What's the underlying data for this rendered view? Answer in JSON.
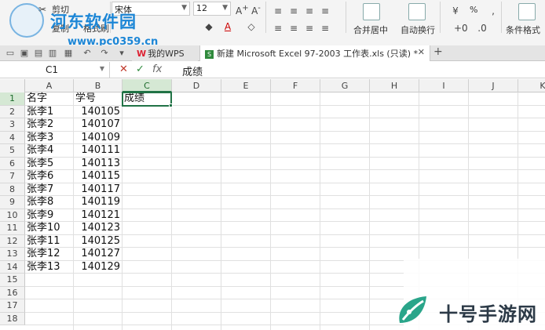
{
  "watermark": {
    "site_name": "河东软件园",
    "site_url": "www.pc0359.cn",
    "corner_brand": "十号手游网"
  },
  "ribbon": {
    "cut_label": "剪切",
    "copy_label": "复制",
    "format_painter_label": "格式刷",
    "font_name": "宋体",
    "font_size": "12",
    "merge_center_label": "合并居中",
    "wrap_text_label": "自动换行",
    "percent_symbol": "%",
    "conditional_format_label": "条件格式"
  },
  "tabs": [
    {
      "label": "我的WPS"
    },
    {
      "label": "新建 Microsoft Excel 97-2003 工作表.xls (只读) *"
    }
  ],
  "formula_bar": {
    "name_box": "C1",
    "fx_label": "fx",
    "content": "成绩"
  },
  "columns": [
    "A",
    "B",
    "C",
    "D",
    "E",
    "F",
    "G",
    "H",
    "I",
    "J",
    "K"
  ],
  "rows": [
    "1",
    "2",
    "3",
    "4",
    "5",
    "6",
    "7",
    "8",
    "9",
    "10",
    "11",
    "12",
    "13",
    "14",
    "15",
    "16",
    "17",
    "18"
  ],
  "cells": {
    "A1": "名字",
    "B1": "学号",
    "C1": "成绩",
    "A2": "张李1",
    "B2": "140105",
    "A3": "张李2",
    "B3": "140107",
    "A4": "张李3",
    "B4": "140109",
    "A5": "张李4",
    "B5": "140111",
    "A6": "张李5",
    "B6": "140113",
    "A7": "张李6",
    "B7": "140115",
    "A8": "张李7",
    "B8": "140117",
    "A9": "张李8",
    "B9": "140119",
    "A10": "张李9",
    "B10": "140121",
    "A11": "张李10",
    "B11": "140123",
    "A12": "张李11",
    "B12": "140125",
    "A13": "张李12",
    "B13": "140127",
    "A14": "张李13",
    "B14": "140129"
  },
  "selection": {
    "cell": "C1"
  },
  "colors": {
    "accent": "#217346",
    "watermark_blue": "#1c86d6"
  }
}
